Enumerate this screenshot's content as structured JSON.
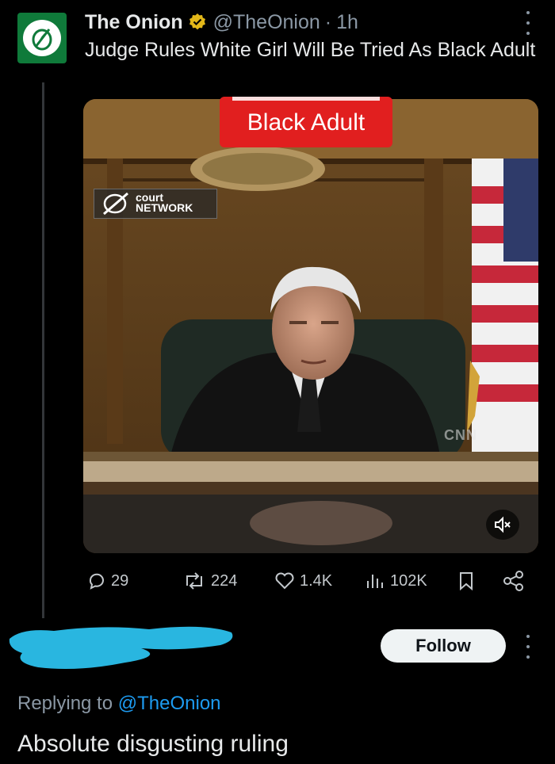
{
  "tweet": {
    "author_name": "The Onion",
    "handle": "@TheOnion",
    "separator": "·",
    "time": "1h",
    "text": "Judge Rules White Girl Will Be Tried As Black Adult",
    "verified_color": "#e2b719"
  },
  "media": {
    "banner_text": "Black Adult",
    "network_logo": [
      "court",
      "NETWORK"
    ],
    "watermark": "CNN"
  },
  "actions": {
    "replies": "29",
    "reposts": "224",
    "likes": "1.4K",
    "views": "102K"
  },
  "reply": {
    "follow_label": "Follow",
    "replying_prefix": "Replying to",
    "replying_handle": "@TheOnion",
    "text": "Absolute disgusting ruling"
  },
  "colors": {
    "accent": "#1d9bf0",
    "background": "#000000",
    "banner_red": "#e11f1f",
    "onion_green": "#0f7a3a",
    "redaction": "#29b6e0"
  }
}
